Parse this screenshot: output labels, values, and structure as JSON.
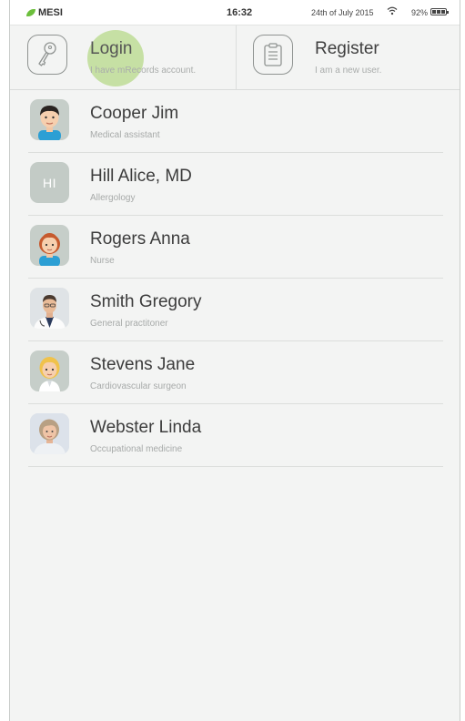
{
  "status_bar": {
    "brand": "MESI",
    "time": "16:32",
    "date": "24th of July 2015",
    "battery": "92%",
    "accent_color": "#6cbf3c"
  },
  "actions": {
    "login": {
      "title": "Login",
      "subtitle": "I have mRecords account.",
      "icon": "key-icon"
    },
    "register": {
      "title": "Register",
      "subtitle": "I am a new user.",
      "icon": "clipboard-icon"
    },
    "ripple_color": "#b7d98a"
  },
  "users": [
    {
      "name": "Cooper Jim",
      "role": "Medical assistant",
      "avatar": "cartoon-man-avatar"
    },
    {
      "name": "Hill Alice, MD",
      "role": "Allergology",
      "avatar": "initials-avatar",
      "initials": "HI"
    },
    {
      "name": "Rogers Anna",
      "role": "Nurse",
      "avatar": "cartoon-redhead-avatar"
    },
    {
      "name": "Smith Gregory",
      "role": "General practitoner",
      "avatar": "doctor-photo-avatar"
    },
    {
      "name": "Stevens Jane",
      "role": "Cardiovascular surgeon",
      "avatar": "cartoon-blonde-avatar"
    },
    {
      "name": "Webster Linda",
      "role": "Occupational medicine",
      "avatar": "woman-photo-avatar"
    }
  ]
}
